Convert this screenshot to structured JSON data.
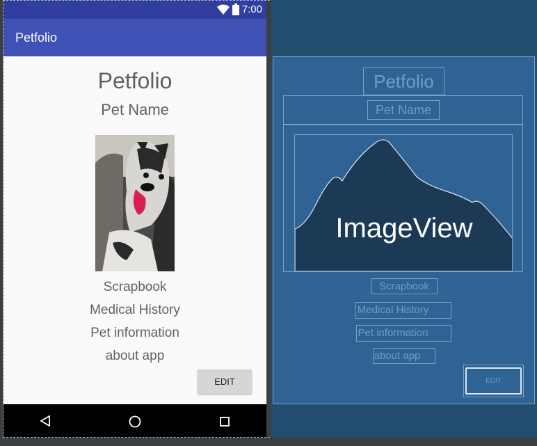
{
  "status_bar": {
    "time": "7:00",
    "wifi_icon": "wifi-icon",
    "battery_icon": "battery-icon"
  },
  "app_bar": {
    "title": "Petfolio"
  },
  "content": {
    "heading": "Petfolio",
    "pet_name": "Pet Name",
    "pet_photo_icon": "dog-photo",
    "menu": [
      "Scrapbook",
      "Medical History",
      "Pet information",
      "about app"
    ],
    "edit_label": "EDIT"
  },
  "nav_bar": {
    "back_icon": "back-icon",
    "home_icon": "home-icon",
    "recents_icon": "recents-icon"
  },
  "blueprint": {
    "heading": "Petfolio",
    "pet_name": "Pet Name",
    "image_label": "ImageView",
    "menu": [
      "Scrapbook",
      "Medical History",
      "Pet information",
      "about app"
    ],
    "edit_label": "EDIT"
  },
  "colors": {
    "primary": "#3f51b5",
    "primary_dark": "#303f9f",
    "blueprint_bg": "#244e70",
    "blueprint_panel": "#2e6394"
  }
}
